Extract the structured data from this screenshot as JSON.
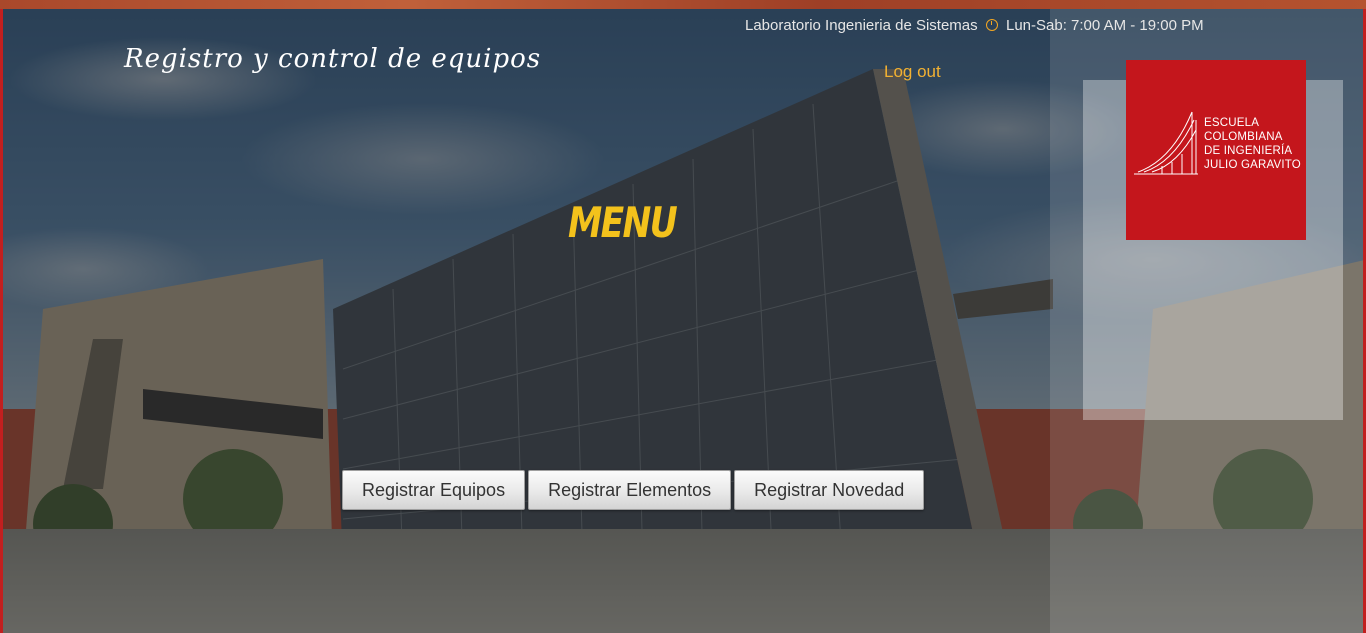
{
  "header": {
    "lab_name": "Laboratorio Ingenieria de Sistemas",
    "schedule": "Lun-Sab: 7:00 AM - 19:00 PM",
    "site_title": "Registro y control de equipos",
    "logout_label": "Log out"
  },
  "main": {
    "menu_title": "MENU",
    "buttons": [
      {
        "label": "Registrar Equipos"
      },
      {
        "label": "Registrar Elementos"
      },
      {
        "label": "Registrar Novedad"
      }
    ]
  },
  "logo": {
    "lines": [
      "Escuela",
      "Colombiana",
      "de Ingeniería",
      "Julio Garavito"
    ],
    "background": "#c4161c"
  },
  "icons": {
    "schedule_icon": "clock-icon"
  },
  "colors": {
    "accent": "#f2b132",
    "menu_title": "#f3c21c"
  }
}
